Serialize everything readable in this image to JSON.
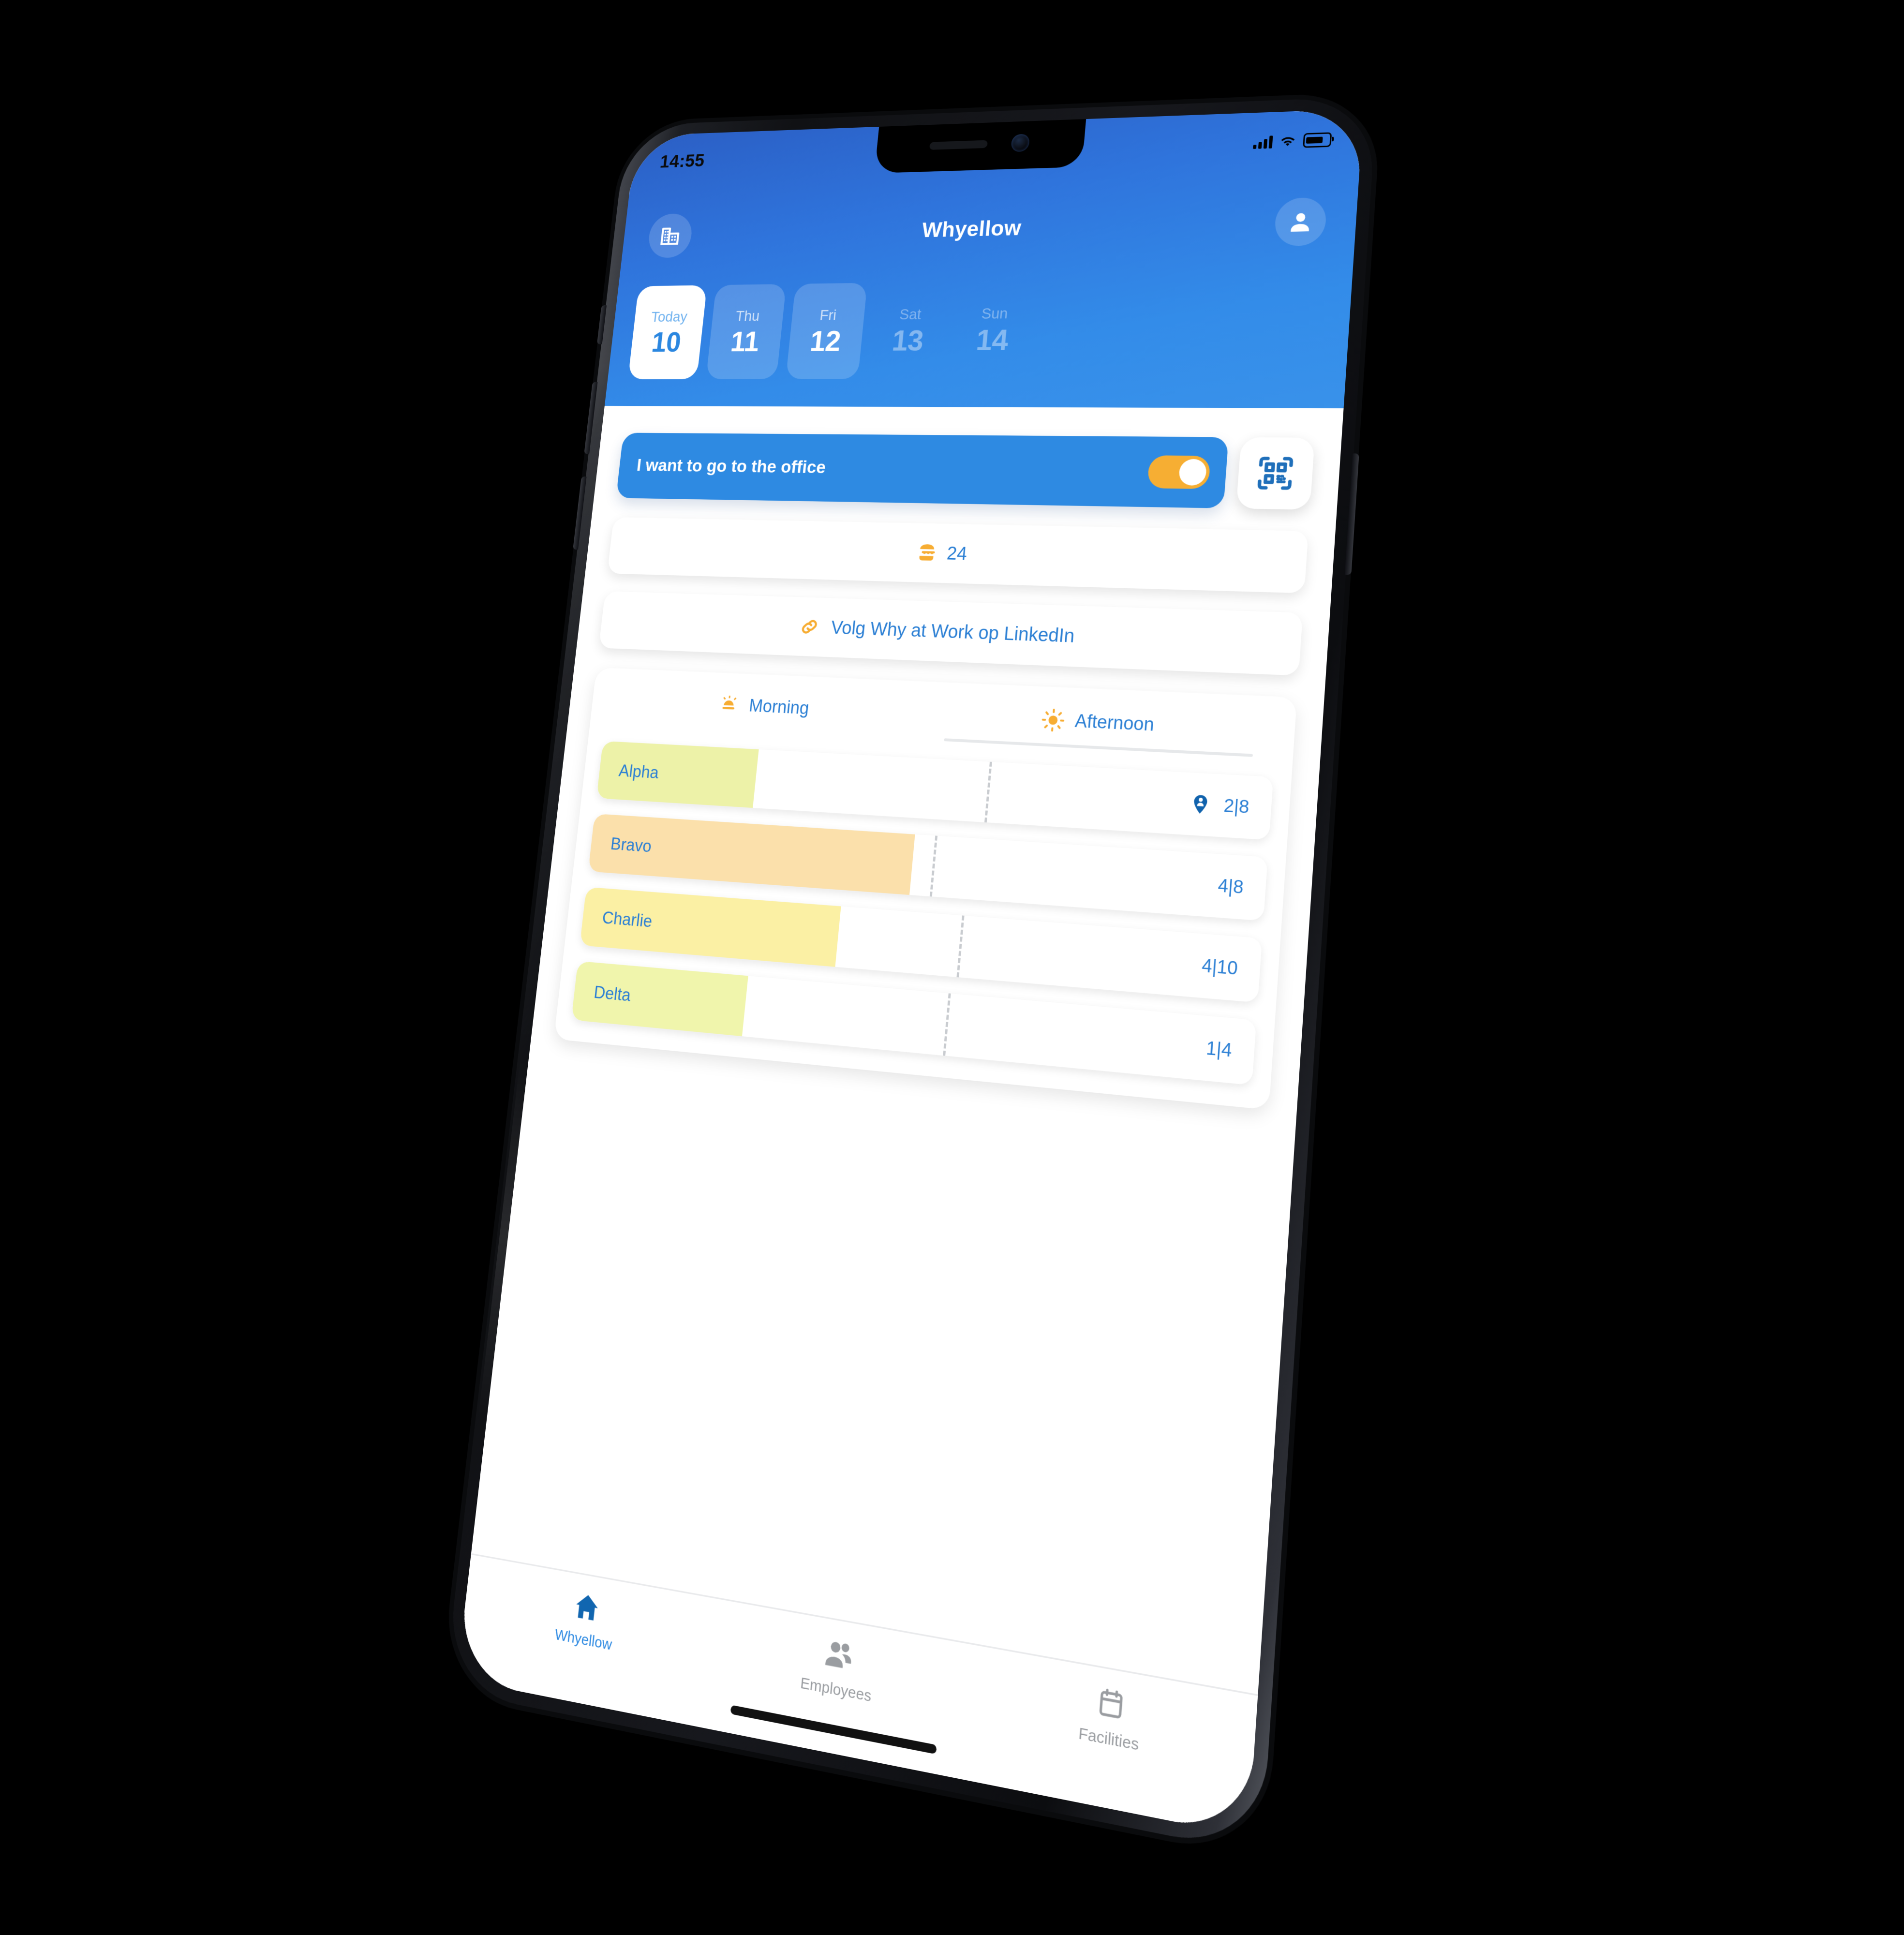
{
  "status_bar": {
    "time": "14:55",
    "signal_icon": "cellular-signal-icon",
    "wifi_icon": "wifi-icon",
    "battery_icon": "battery-icon"
  },
  "header": {
    "title": "Whyellow",
    "office_icon": "office-building-icon",
    "profile_icon": "user-avatar-icon",
    "accent_blue": "#2e8ae2",
    "accent_orange": "#f6ae33"
  },
  "date_strip": {
    "days": [
      {
        "dow": "Today",
        "date": "10",
        "state": "active"
      },
      {
        "dow": "Thu",
        "date": "11",
        "state": "selectable"
      },
      {
        "dow": "Fri",
        "date": "12",
        "state": "selectable"
      },
      {
        "dow": "Sat",
        "date": "13",
        "state": "disabled"
      },
      {
        "dow": "Sun",
        "date": "14",
        "state": "disabled"
      }
    ]
  },
  "office_toggle": {
    "label": "I want to go to the office",
    "value": "on",
    "toggle_icon": "toggle-switch-on-icon"
  },
  "qr_button": {
    "icon": "qr-code-scan-icon"
  },
  "lunch": {
    "icon": "hamburger-icon",
    "count": "24"
  },
  "linkedin": {
    "icon": "link-icon",
    "label": "Volg Why at Work op LinkedIn"
  },
  "period_tabs": [
    {
      "label": "Morning",
      "icon": "sunrise-icon",
      "active": false
    },
    {
      "label": "Afternoon",
      "icon": "sun-icon",
      "active": true
    }
  ],
  "rooms_panel": {
    "location_icon": "location-pin-person-icon",
    "rooms": [
      {
        "name": "Alpha",
        "count": "2|8",
        "occupied": 2,
        "capacity": 8,
        "fill_pct": 25,
        "marker_pct": 60,
        "fill_color": "#edf2a8",
        "show_pin": true
      },
      {
        "name": "Bravo",
        "count": "4|8",
        "occupied": 4,
        "capacity": 8,
        "fill_pct": 50,
        "marker_pct": 53,
        "fill_color": "#fbe0ab",
        "show_pin": false
      },
      {
        "name": "Charlie",
        "count": "4|10",
        "occupied": 4,
        "capacity": 10,
        "fill_pct": 40,
        "marker_pct": 58,
        "fill_color": "#fbf0a4",
        "show_pin": false
      },
      {
        "name": "Delta",
        "count": "1|4",
        "occupied": 1,
        "capacity": 4,
        "fill_pct": 27,
        "marker_pct": 57,
        "fill_color": "#f0f5ac",
        "show_pin": false
      }
    ]
  },
  "tab_bar": {
    "items": [
      {
        "label": "Whyellow",
        "icon": "home-icon",
        "active": true
      },
      {
        "label": "Employees",
        "icon": "people-icon",
        "active": false
      },
      {
        "label": "Facilities",
        "icon": "calendar-icon",
        "active": false
      }
    ]
  }
}
